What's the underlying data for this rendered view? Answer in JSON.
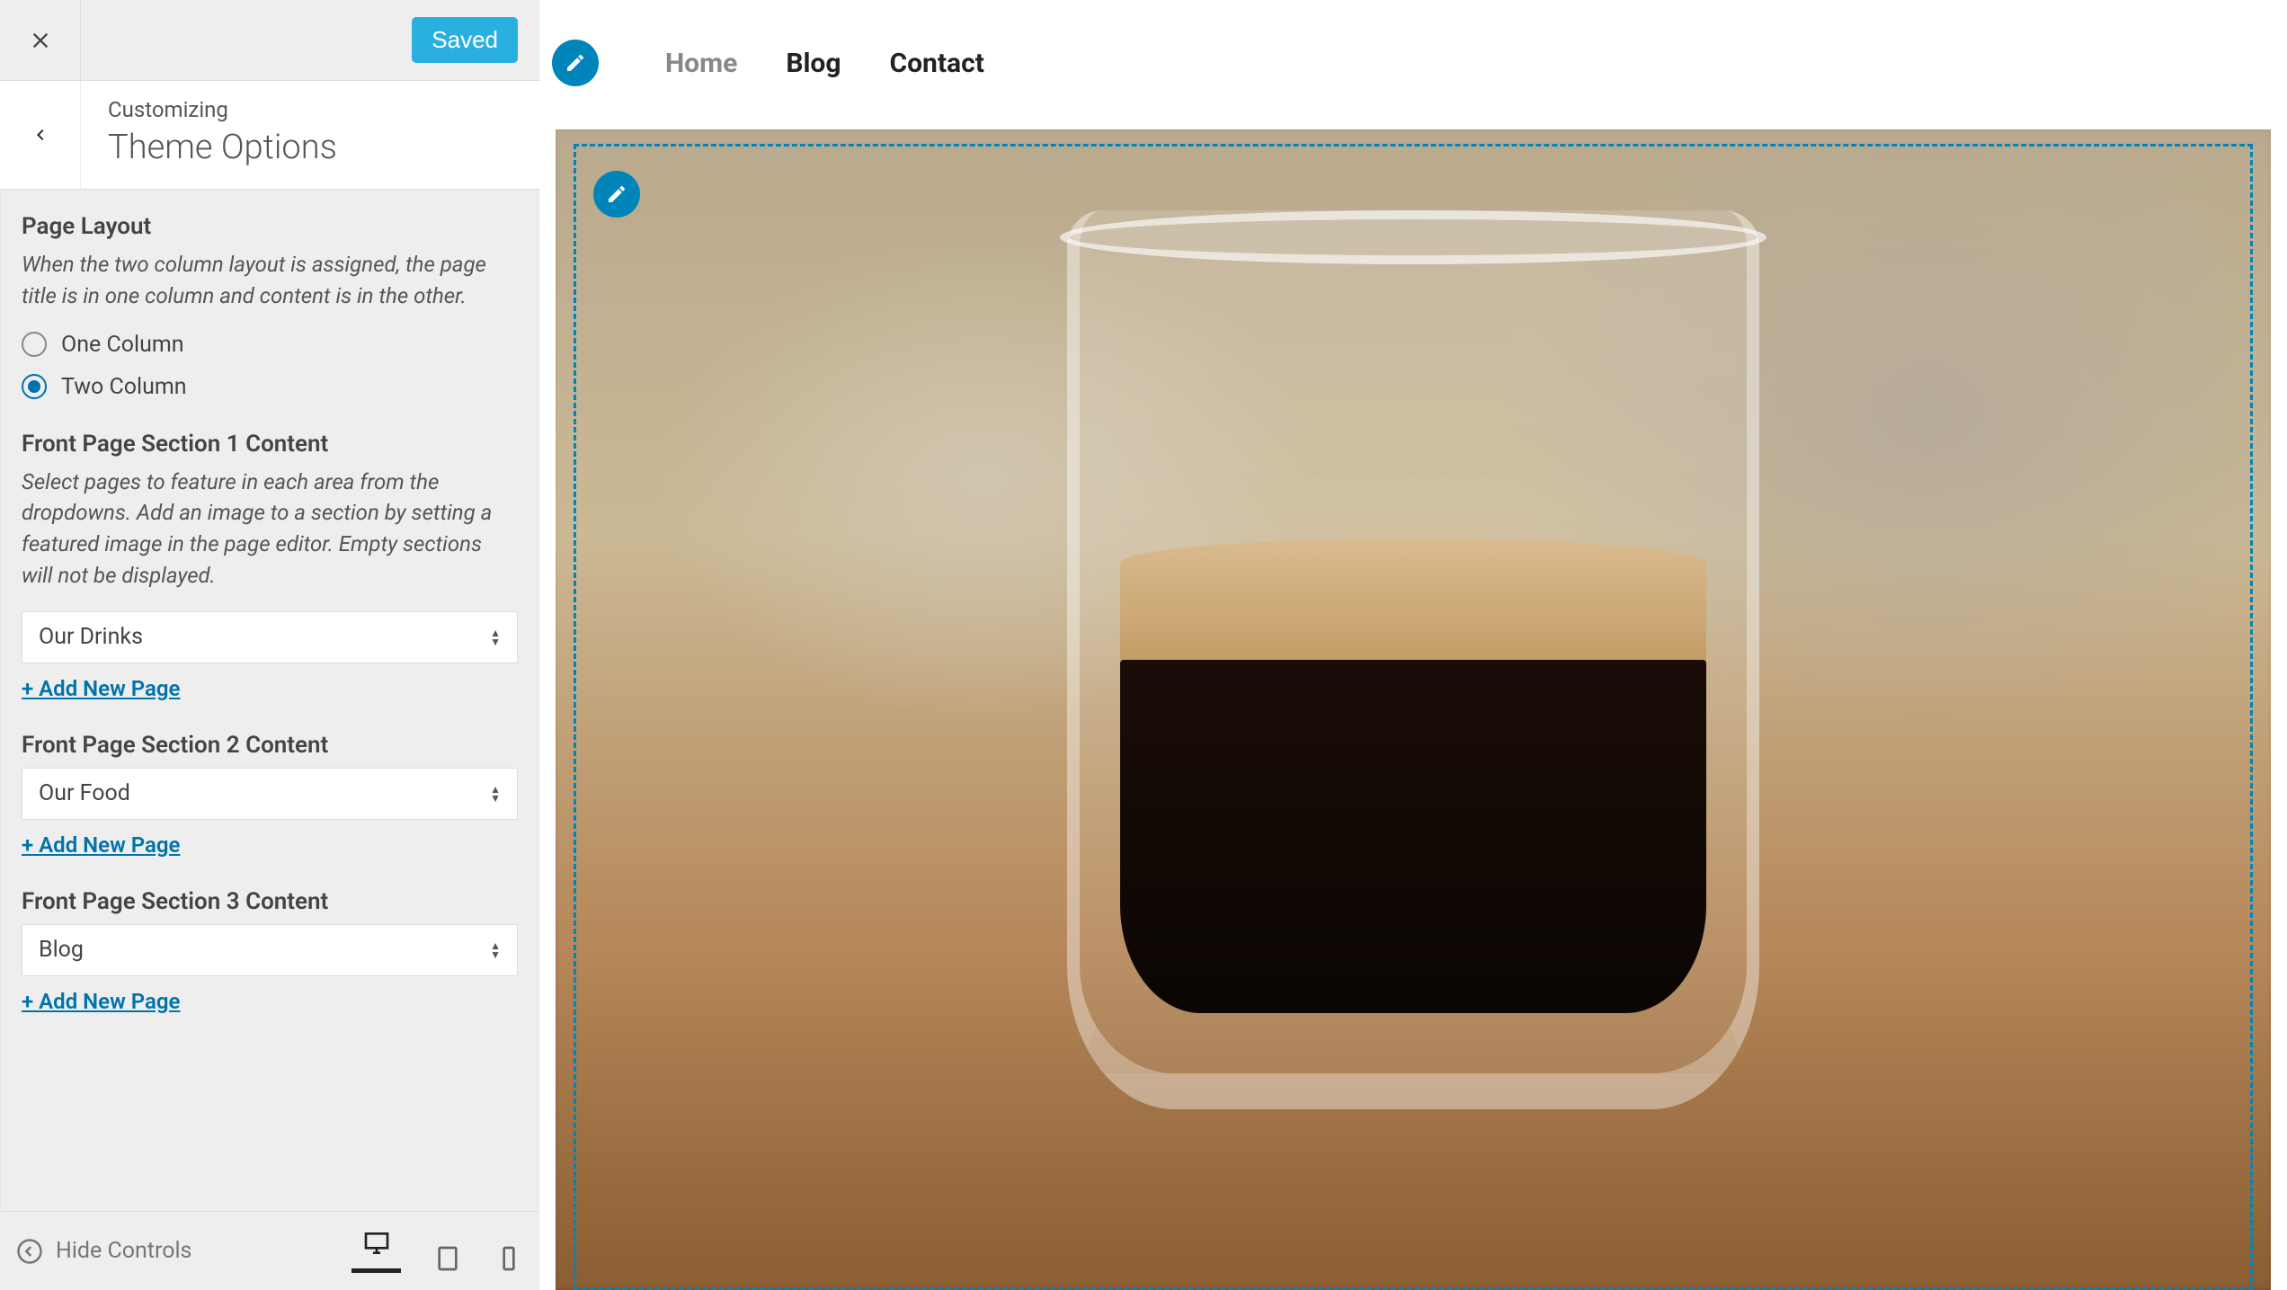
{
  "sidebar": {
    "saved_label": "Saved",
    "customizing_label": "Customizing",
    "panel_title": "Theme Options",
    "page_layout": {
      "title": "Page Layout",
      "desc": "When the two column layout is assigned, the page title is in one column and content is in the other.",
      "options": [
        "One Column",
        "Two Column"
      ],
      "selected_index": 1
    },
    "section1": {
      "title": "Front Page Section 1 Content",
      "desc": "Select pages to feature in each area from the dropdowns. Add an image to a section by setting a featured image in the page editor. Empty sections will not be displayed.",
      "value": "Our Drinks",
      "add_label": "+ Add New Page"
    },
    "section2": {
      "title": "Front Page Section 2 Content",
      "value": "Our Food",
      "add_label": "+ Add New Page"
    },
    "section3": {
      "title": "Front Page Section 3 Content",
      "value": "Blog",
      "add_label": "+ Add New Page"
    }
  },
  "footer": {
    "collapse_label": "Hide Controls"
  },
  "preview": {
    "nav": [
      "Home",
      "Blog",
      "Contact"
    ],
    "active_index": 0
  }
}
